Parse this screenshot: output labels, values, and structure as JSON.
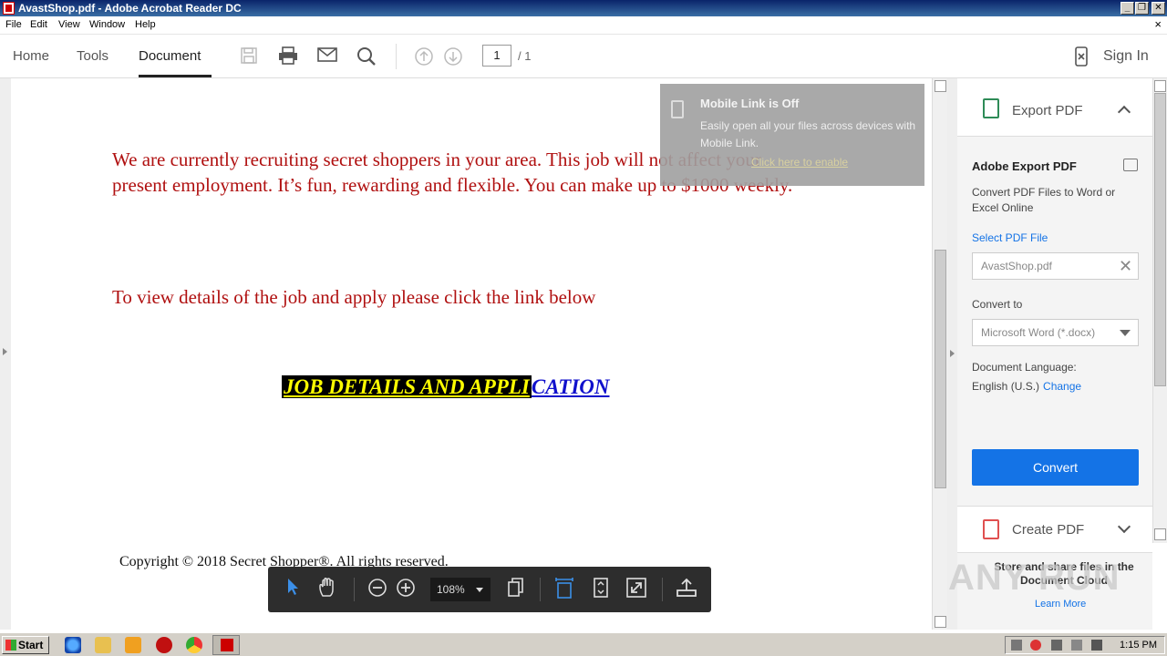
{
  "window": {
    "title": "AvastShop.pdf - Adobe Acrobat Reader DC",
    "controls": {
      "minimize": "_",
      "maximize": "❐",
      "close": "✕"
    }
  },
  "menu": [
    "File",
    "Edit",
    "View",
    "Window",
    "Help"
  ],
  "menu_close": "×",
  "tabs": {
    "home": "Home",
    "tools": "Tools",
    "document": "Document"
  },
  "page_nav": {
    "current": "1",
    "total": "/ 1"
  },
  "sign_in": "Sign In",
  "document": {
    "paragraph1": "We are currently recruiting secret shoppers in your area. This job will not affect your present employment. It’s fun, rewarding and flexible.  You can make up to $1000 weekly.",
    "paragraph2": "To view details of the job and apply please click the link below",
    "link_part1": "JOB DETAILS AND APPLI",
    "link_part2": "CATION",
    "copyright": "Copyright © 2018 Secret Shopper®. All rights reserved."
  },
  "mobile_link": {
    "title": "Mobile Link is Off",
    "desc": "Easily open all your files across devices with Mobile Link.",
    "link": "Click here to enable"
  },
  "right_pane": {
    "export_header": "Export PDF",
    "title": "Adobe Export PDF",
    "desc": "Convert PDF Files to Word or Excel Online",
    "select_file": "Select PDF File",
    "file_name": "AvastShop.pdf",
    "convert_to_label": "Convert to",
    "convert_to_value": "Microsoft Word (*.docx)",
    "language_label": "Document Language:",
    "language_value": "English (U.S.)",
    "change": "Change",
    "convert_button": "Convert",
    "create_header": "Create PDF",
    "store_text": "Store and share files in the Document Cloud",
    "learn_more": "Learn More"
  },
  "zoom": "108%",
  "watermark": "ANY RUN",
  "taskbar": {
    "start": "Start",
    "clock": "1:15 PM"
  },
  "colors": {
    "accent": "#1473e6",
    "doc_text": "#b01010",
    "link_highlight": "#ffff00"
  }
}
